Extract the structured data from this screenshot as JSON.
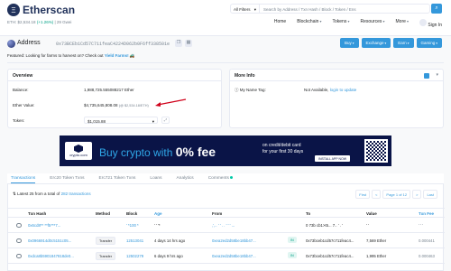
{
  "header": {
    "logo_mark": "Ξ",
    "logo_text": "Etherscan",
    "price_prefix": "ETH: ",
    "price_value": "$2,534.18",
    "price_change": "(+1.26%)",
    "gas": "| 29 Gwei",
    "search_filter": "All Filters",
    "search_placeholder": "Search by Address / Txn Hash / Block / Token / Ens",
    "nav": [
      "Home",
      "Blockchain",
      "Tokens",
      "Resources",
      "More"
    ],
    "sign_in": "Sign In"
  },
  "address_bar": {
    "title": "Address",
    "hash": "0x73BCEb1Cd57C711feaC4224D062b0F6ff338501e",
    "buttons": [
      "Buy",
      "Exchange",
      "Earn",
      "Gaming"
    ]
  },
  "featured": {
    "prefix": "Featured: Looking for farms to harvest on? Check out ",
    "link": "Yield Farms!",
    "emoji": "🚜"
  },
  "overview": {
    "heading": "Overview",
    "balance_label": "Balance:",
    "balance_value": "1,988,725.555088217 Ether",
    "ether_value_label": "Ether Value:",
    "ether_value": "$4,735,645,808.08",
    "ether_value_rate": "(@ $2,534.18/ETH)",
    "token_label": "Token:",
    "token_value": "$1,015.88"
  },
  "more_info": {
    "heading": "More Info",
    "name_tag_label": "My Name Tag:",
    "name_tag_value": "Not Available, ",
    "name_tag_link": "login to update"
  },
  "banner": {
    "brand": "crypto.com",
    "text_light": "Buy crypto with ",
    "text_bold": "0% fee",
    "sub1": "on credit/debit card",
    "sub2": "for your first 30 days",
    "cta": "INSTALL APP NOW"
  },
  "tabs": [
    "Transactions",
    "Erc20 Token Txns",
    "Erc721 Token Txns",
    "Loans",
    "Analytics",
    "Comments"
  ],
  "table": {
    "latest": "Latest 25 from a total of ",
    "total_link": "282 transactions",
    "pager": [
      "First",
      "<",
      "Page 1 of 12",
      ">",
      "Last"
    ],
    "columns": [
      "Txn Hash",
      "Method",
      "Block",
      "Age",
      "From",
      "To",
      "Value",
      "Txn Fee"
    ],
    "rows": [
      {
        "hash": "0x6cd8**  **f5***7...",
        "method": "",
        "block": "' *100 *",
        "age": "'  '    '*",
        "from": ",',.. ' ' . . ' ' ' ... ",
        "dir": "",
        "to": "0 73b cb1>t5...   7.. '  . '",
        "value": "' '    ",
        "fee": "' ' ' "
      },
      {
        "hash": "0x0966914d0c5151c05...",
        "method": "Transfer",
        "block": "12513041",
        "age": "4 days 14 hrs ago",
        "from": "0xea2ed2d58be18bb47...",
        "dir": "IN",
        "to": "0x73bceb1cd57c711feac4...",
        "value": "7,569 Ether",
        "fee": "0.000441"
      },
      {
        "hash": "0xdca8b5901847818de0...",
        "method": "Transfer",
        "block": "12502279",
        "age": "6 days 9 hrs ago",
        "from": "0xea2ed2d58be18bb47...",
        "dir": "IN",
        "to": "0x73bceb1cd57c711feac4...",
        "value": "1,995 Ether",
        "fee": "0.000463"
      }
    ]
  }
}
